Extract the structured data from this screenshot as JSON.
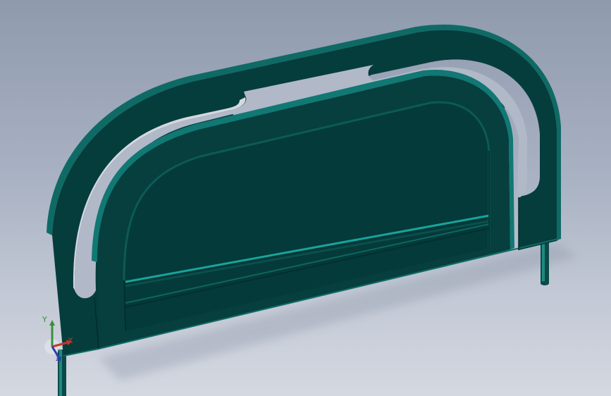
{
  "viewport": {
    "background_top": "#8f9aad",
    "background_bottom": "#d4d8e1"
  },
  "model": {
    "part": "bed-headboard",
    "face_color": "#053d3c",
    "edge_color": "#0f5c5a",
    "highlight_color": "#1a8c86"
  },
  "triad": {
    "x_label": "X",
    "y_label": "Y",
    "z_label": "Z",
    "x_color": "#c0392b",
    "y_color": "#3a8f3a",
    "z_color": "#2c3ea8"
  }
}
